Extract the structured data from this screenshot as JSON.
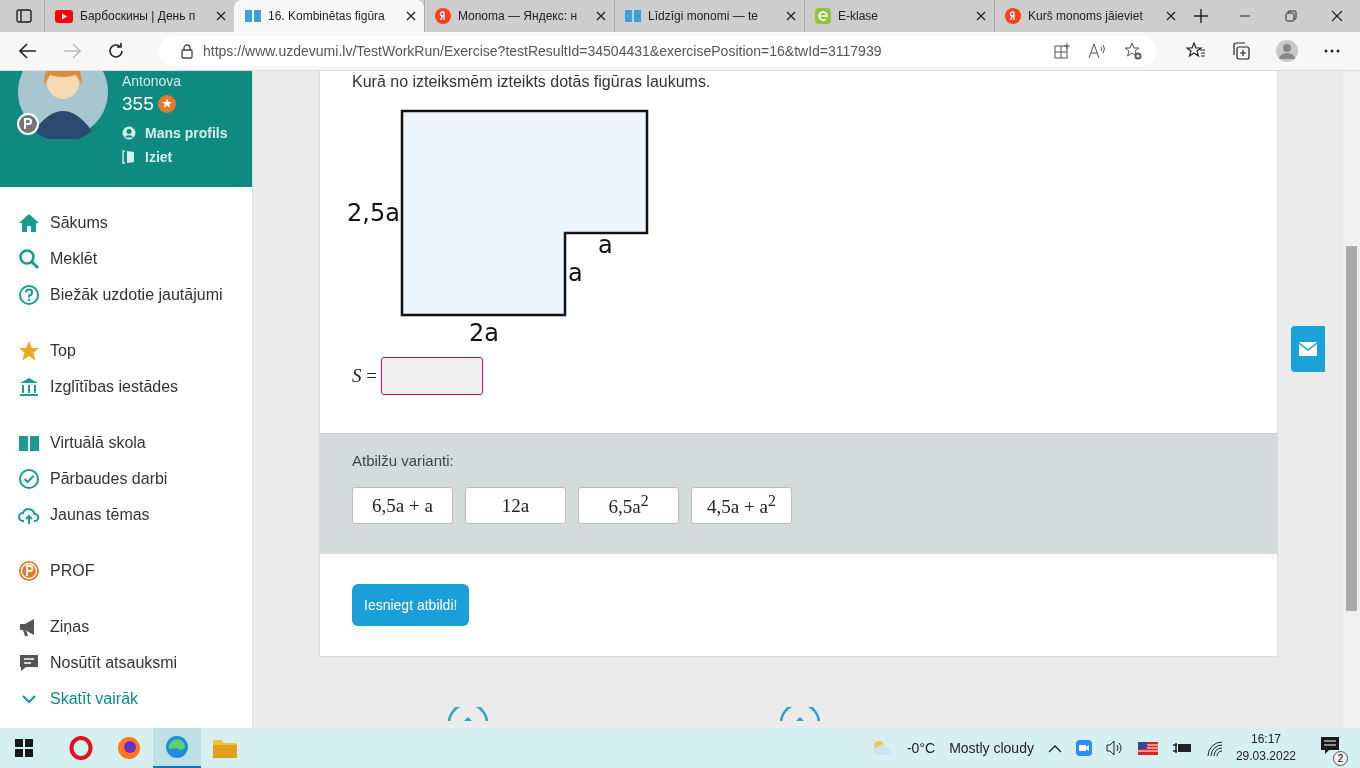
{
  "tabs": [
    {
      "title": "Барбоскины | День п",
      "kind": "youtube",
      "selected": false
    },
    {
      "title": "16. Kombinētas figūra",
      "kind": "book",
      "selected": true
    },
    {
      "title": "Monoma — Яндекс: н",
      "kind": "yandex",
      "selected": false
    },
    {
      "title": "Līdzīgi monomi — te",
      "kind": "book",
      "selected": false
    },
    {
      "title": "E-klase",
      "kind": "eklase",
      "selected": false
    },
    {
      "title": "Kurš monoms jāieviet",
      "kind": "yandex",
      "selected": false
    }
  ],
  "address_bar": {
    "url": "https://www.uzdevumi.lv/TestWorkRun/Exercise?testResultId=34504431&exercisePosition=16&twId=3117939"
  },
  "profile": {
    "name": "Antonova",
    "points": "355",
    "links": [
      {
        "label": "Mans profils",
        "kind": "user"
      },
      {
        "label": "Iziet",
        "kind": "door"
      }
    ]
  },
  "sidebar": {
    "groups": [
      [
        {
          "label": "Sākums",
          "kind": "home"
        },
        {
          "label": "Meklēt",
          "kind": "search"
        },
        {
          "label": "Biežāk uzdotie jautājumi",
          "kind": "help"
        }
      ],
      [
        {
          "label": "Top",
          "kind": "star"
        },
        {
          "label": "Izglītības iestādes",
          "kind": "bank"
        }
      ],
      [
        {
          "label": "Virtuālā skola",
          "kind": "book"
        },
        {
          "label": "Pārbaudes darbi",
          "kind": "check"
        },
        {
          "label": "Jaunas tēmas",
          "kind": "cloud"
        }
      ],
      [
        {
          "label": "PROF",
          "kind": "prof"
        }
      ],
      [
        {
          "label": "Ziņas",
          "kind": "megaphone"
        },
        {
          "label": "Nosūtīt atsauksmi",
          "kind": "comment"
        },
        {
          "label": "Skatīt vairāk",
          "kind": "chevron"
        }
      ]
    ]
  },
  "exercise": {
    "question": "Kurā no izteiksmēm izteikts dotās figūras laukums.",
    "figure_labels": {
      "left": "2,5a",
      "step_top": "a",
      "step_side": "a",
      "bottom": "2a"
    },
    "answer_label": "*S* =",
    "options_title": "Atbilžu varianti:",
    "options": [
      "6,5a + a",
      "12a",
      "6,5a$^{2}$",
      "4,5a + a$^{2}$"
    ],
    "submit": "Iesniegt atbildi!"
  },
  "taskbar": {
    "apps": [
      {
        "kind": "opera",
        "selected": false
      },
      {
        "kind": "firefox",
        "selected": false
      },
      {
        "kind": "edge",
        "selected": true
      },
      {
        "kind": "folder",
        "selected": false
      }
    ],
    "weather": "-0°C",
    "weather_text": "Mostly cloudy",
    "time": "16:17",
    "date": "29.03.2022",
    "notifications": "2"
  }
}
